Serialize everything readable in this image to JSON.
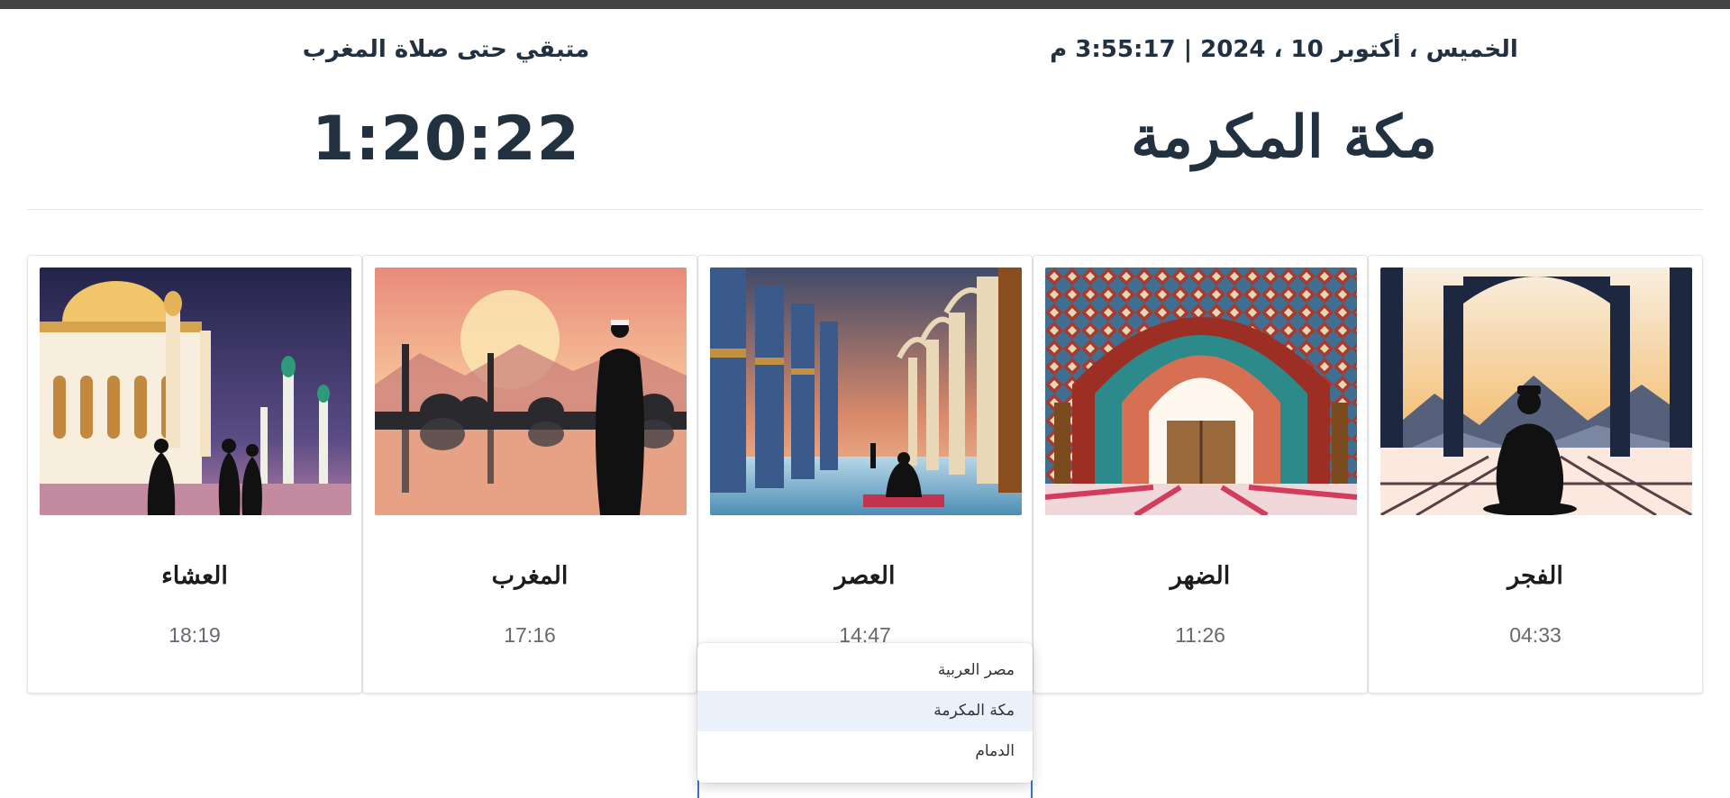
{
  "header": {
    "datetime": "الخميس ، أكتوبر 10 ، 2024 | 3:55:17 م",
    "city": "مكة المكرمة",
    "countdown_label": "متبقي حتى صلاة المغرب",
    "countdown": "1:20:22"
  },
  "prayers": [
    {
      "name": "الفجر",
      "time": "04:33",
      "image": "fajr-prayer-illustration"
    },
    {
      "name": "الضهر",
      "time": "11:26",
      "image": "dhuhr-mosque-arch-illustration"
    },
    {
      "name": "العصر",
      "time": "14:47",
      "image": "asr-mosque-colonnade-illustration"
    },
    {
      "name": "المغرب",
      "time": "17:16",
      "image": "maghrib-sunset-illustration"
    },
    {
      "name": "العشاء",
      "time": "18:19",
      "image": "isha-mosque-night-illustration"
    }
  ],
  "city_select": {
    "options": [
      "مصر العربية",
      "مكة المكرمة",
      "الدمام"
    ],
    "selected": "مكة المكرمة"
  }
}
